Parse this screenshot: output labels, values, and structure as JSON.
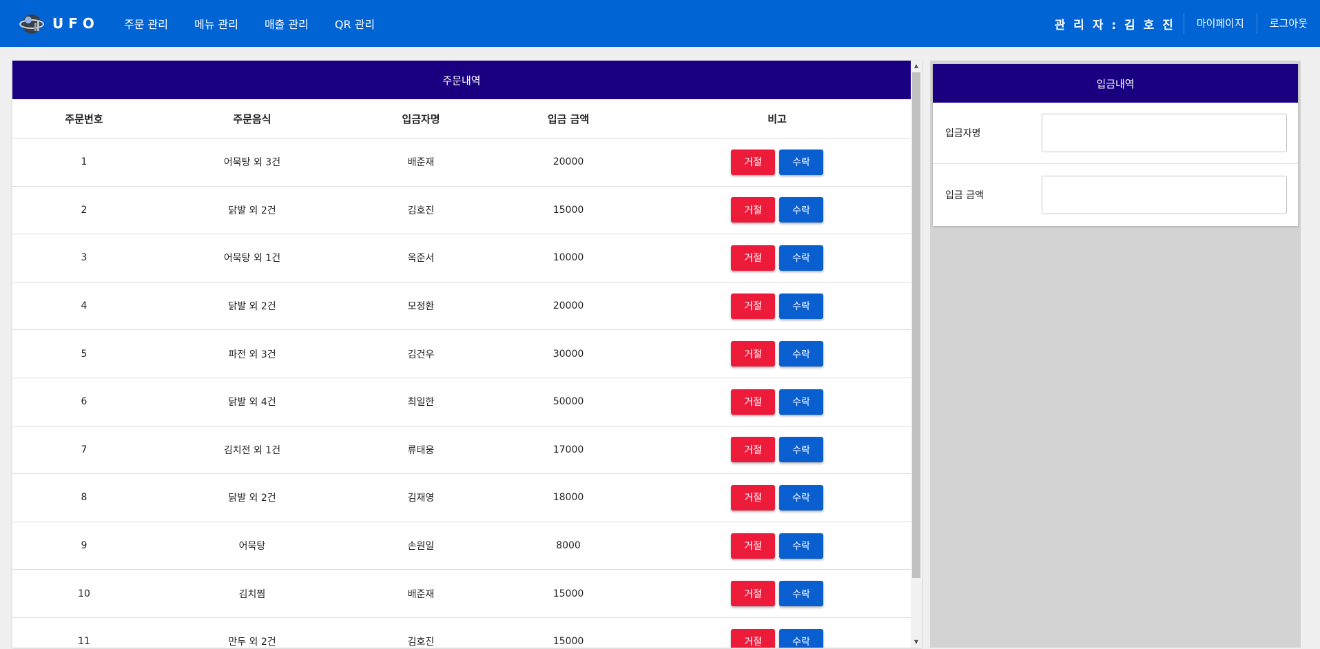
{
  "brand": {
    "name": "UFO"
  },
  "nav": {
    "items": [
      "주문 관리",
      "메뉴 관리",
      "매출 관리",
      "QR 관리"
    ]
  },
  "topright": {
    "admin": "관 리 자 : 김 호 진",
    "mypage": "마이페이지",
    "logout": "로그아웃"
  },
  "orders": {
    "title": "주문내역",
    "headers": {
      "no": "주문번호",
      "food": "주문음식",
      "depositor": "입금자명",
      "amount": "입금 금액",
      "note": "비고"
    },
    "reject_label": "거절",
    "accept_label": "수락",
    "rows": [
      {
        "no": "1",
        "food": "어묵탕 외 3건",
        "depositor": "배준재",
        "amount": "20000"
      },
      {
        "no": "2",
        "food": "닭발 외 2건",
        "depositor": "김호진",
        "amount": "15000"
      },
      {
        "no": "3",
        "food": "어묵탕 외 1건",
        "depositor": "옥준서",
        "amount": "10000"
      },
      {
        "no": "4",
        "food": "닭발 외 2건",
        "depositor": "모정환",
        "amount": "20000"
      },
      {
        "no": "5",
        "food": "파전 외 3건",
        "depositor": "김건우",
        "amount": "30000"
      },
      {
        "no": "6",
        "food": "닭발 외 4건",
        "depositor": "최일한",
        "amount": "50000"
      },
      {
        "no": "7",
        "food": "김치전 외 1건",
        "depositor": "류태웅",
        "amount": "17000"
      },
      {
        "no": "8",
        "food": "닭발 외 2건",
        "depositor": "김재영",
        "amount": "18000"
      },
      {
        "no": "9",
        "food": "어묵탕",
        "depositor": "손원일",
        "amount": "8000"
      },
      {
        "no": "10",
        "food": "김치찜",
        "depositor": "배준재",
        "amount": "15000"
      },
      {
        "no": "11",
        "food": "만두 외 2건",
        "depositor": "김호진",
        "amount": "15000"
      }
    ]
  },
  "deposit": {
    "title": "입금내역",
    "depositor_label": "입금자명",
    "depositor_value": "",
    "amount_label": "입금 금액",
    "amount_value": ""
  },
  "colors": {
    "topbar": "#0064d4",
    "panel_header": "#1a0080",
    "reject": "#ec1b3a",
    "accept": "#0a5fd0"
  }
}
